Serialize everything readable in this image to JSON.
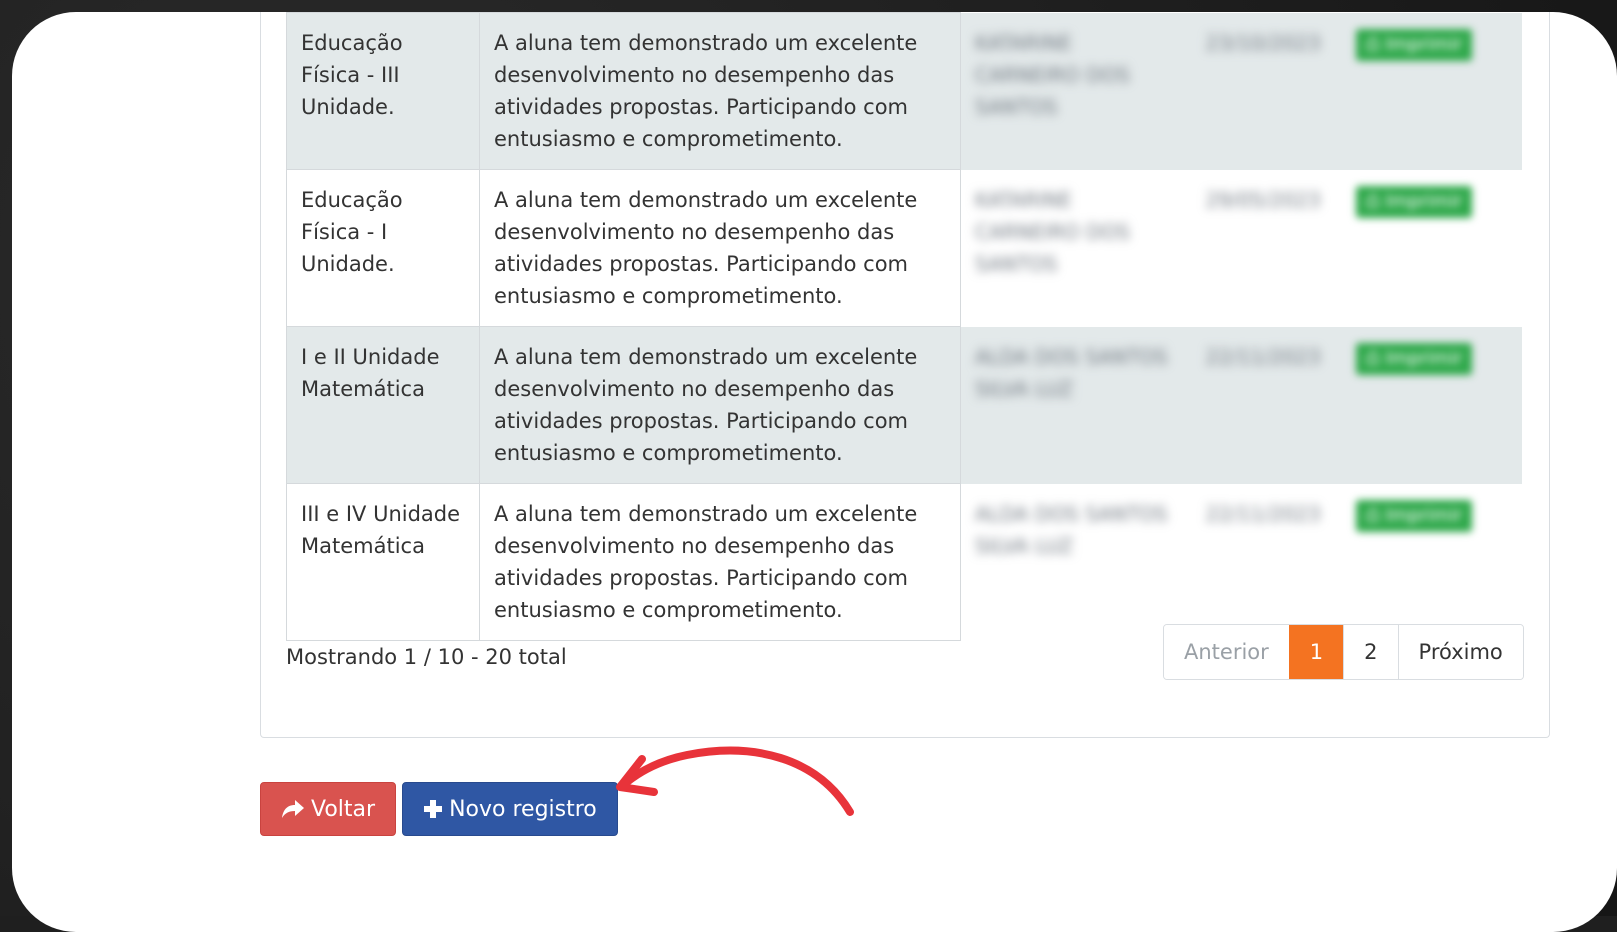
{
  "table": {
    "rows": [
      {
        "discipline": "Educação Física - III Unidade.",
        "description": "A aluna tem demonstrado um excelente desenvolvimento no desempenho das atividades propostas. Participando com entusiasmo e comprometimento.",
        "teacher": "KATARINE CARNEIRO DOS SANTOS",
        "date": "23/10/2023",
        "print_label": "Imprimir"
      },
      {
        "discipline": "Educação Física - I Unidade.",
        "description": "A aluna tem demonstrado um excelente desenvolvimento no desempenho das atividades propostas. Participando com entusiasmo e comprometimento.",
        "teacher": "KATARINE CARNEIRO DOS SANTOS",
        "date": "29/05/2023",
        "print_label": "Imprimir"
      },
      {
        "discipline": "I e II Unidade Matemática",
        "description": "A aluna tem demonstrado um excelente desenvolvimento no desempenho das atividades propostas. Participando com entusiasmo e comprometimento.",
        "teacher": "ALDA DOS SANTOS SILVA LUZ",
        "date": "22/11/2023",
        "print_label": "Imprimir"
      },
      {
        "discipline": "III e IV Unidade Matemática",
        "description": "A aluna tem demonstrado um excelente desenvolvimento no desempenho das atividades propostas. Participando com entusiasmo e comprometimento.",
        "teacher": "ALDA DOS SANTOS SILVA LUZ",
        "date": "22/11/2023",
        "print_label": "Imprimir"
      }
    ]
  },
  "pager": {
    "info": "Mostrando 1 / 10 - 20 total",
    "prev": "Anterior",
    "pages": [
      "1",
      "2"
    ],
    "next": "Próximo",
    "active_page": "1"
  },
  "actions": {
    "back_label": "Voltar",
    "new_label": "Novo registro",
    "back_icon": "share-arrow-icon",
    "new_icon": "plus-icon"
  },
  "colors": {
    "accent_orange": "#f47321",
    "back_red": "#d9534f",
    "new_blue": "#2f57a4",
    "print_green": "#2ea84a",
    "annotation_red": "#e8333a"
  }
}
